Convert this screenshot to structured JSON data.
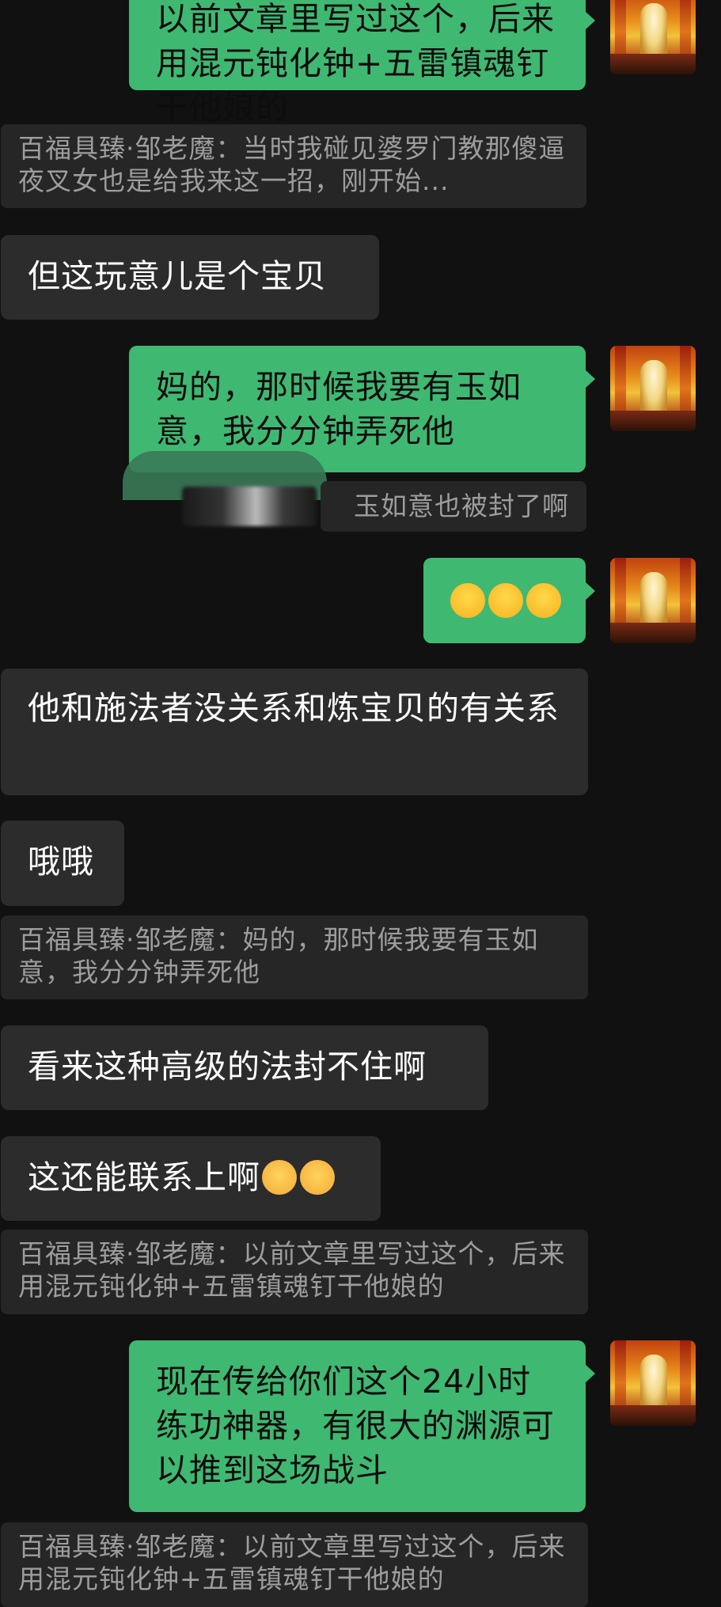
{
  "messages": [
    {
      "id": "m1",
      "side": "me",
      "text": "以前文章里写过这个，后来用混元钝化钟+五雷镇魂钉干他娘的"
    },
    {
      "id": "q1",
      "type": "quote",
      "text": "百福具臻·邹老魔：当时我碰见婆罗门教那傻逼夜叉女也是给我来这一招，刚开始..."
    },
    {
      "id": "m2",
      "side": "them",
      "text": "但这玩意儿是个宝贝"
    },
    {
      "id": "m3",
      "side": "me",
      "text": "妈的，那时候我要有玉如意，我分分钟弄死他"
    },
    {
      "id": "q2",
      "type": "quote",
      "text": "玉如意也被封了啊"
    },
    {
      "id": "m4",
      "side": "me",
      "emoji": "face-with-tears-of-joy",
      "emoji_count": 3
    },
    {
      "id": "m5",
      "side": "them",
      "text": "他和施法者没关系和炼宝贝的有关系"
    },
    {
      "id": "m6",
      "side": "them",
      "text": "哦哦"
    },
    {
      "id": "q3",
      "type": "quote",
      "text": "百福具臻·邹老魔：妈的，那时候我要有玉如意，我分分钟弄死他"
    },
    {
      "id": "m7",
      "side": "them",
      "text": "看来这种高级的法封不住啊"
    },
    {
      "id": "m8",
      "side": "them",
      "text": "这还能联系上啊",
      "emoji": "flushed-face",
      "emoji_count": 2
    },
    {
      "id": "q4",
      "type": "quote",
      "text": "百福具臻·邹老魔：以前文章里写过这个，后来用混元钝化钟+五雷镇魂钉干他娘的"
    },
    {
      "id": "m9",
      "side": "me",
      "text": "现在传给你们这个24小时练功神器，有很大的渊源可以推到这场战斗"
    },
    {
      "id": "q5",
      "type": "quote",
      "text": "百福具臻·邹老魔：以前文章里写过这个，后来用混元钝化钟+五雷镇魂钉干他娘的"
    }
  ],
  "icons": {
    "avatar": "shrine-avatar-icon",
    "laugh": "face-with-tears-of-joy-icon",
    "flushed": "flushed-face-icon"
  },
  "colors": {
    "background": "#111111",
    "outgoing_bubble": "#3fb872",
    "incoming_bubble": "#2c2c2c",
    "quote_bubble": "#262626",
    "quote_text": "#9d9d9d"
  }
}
